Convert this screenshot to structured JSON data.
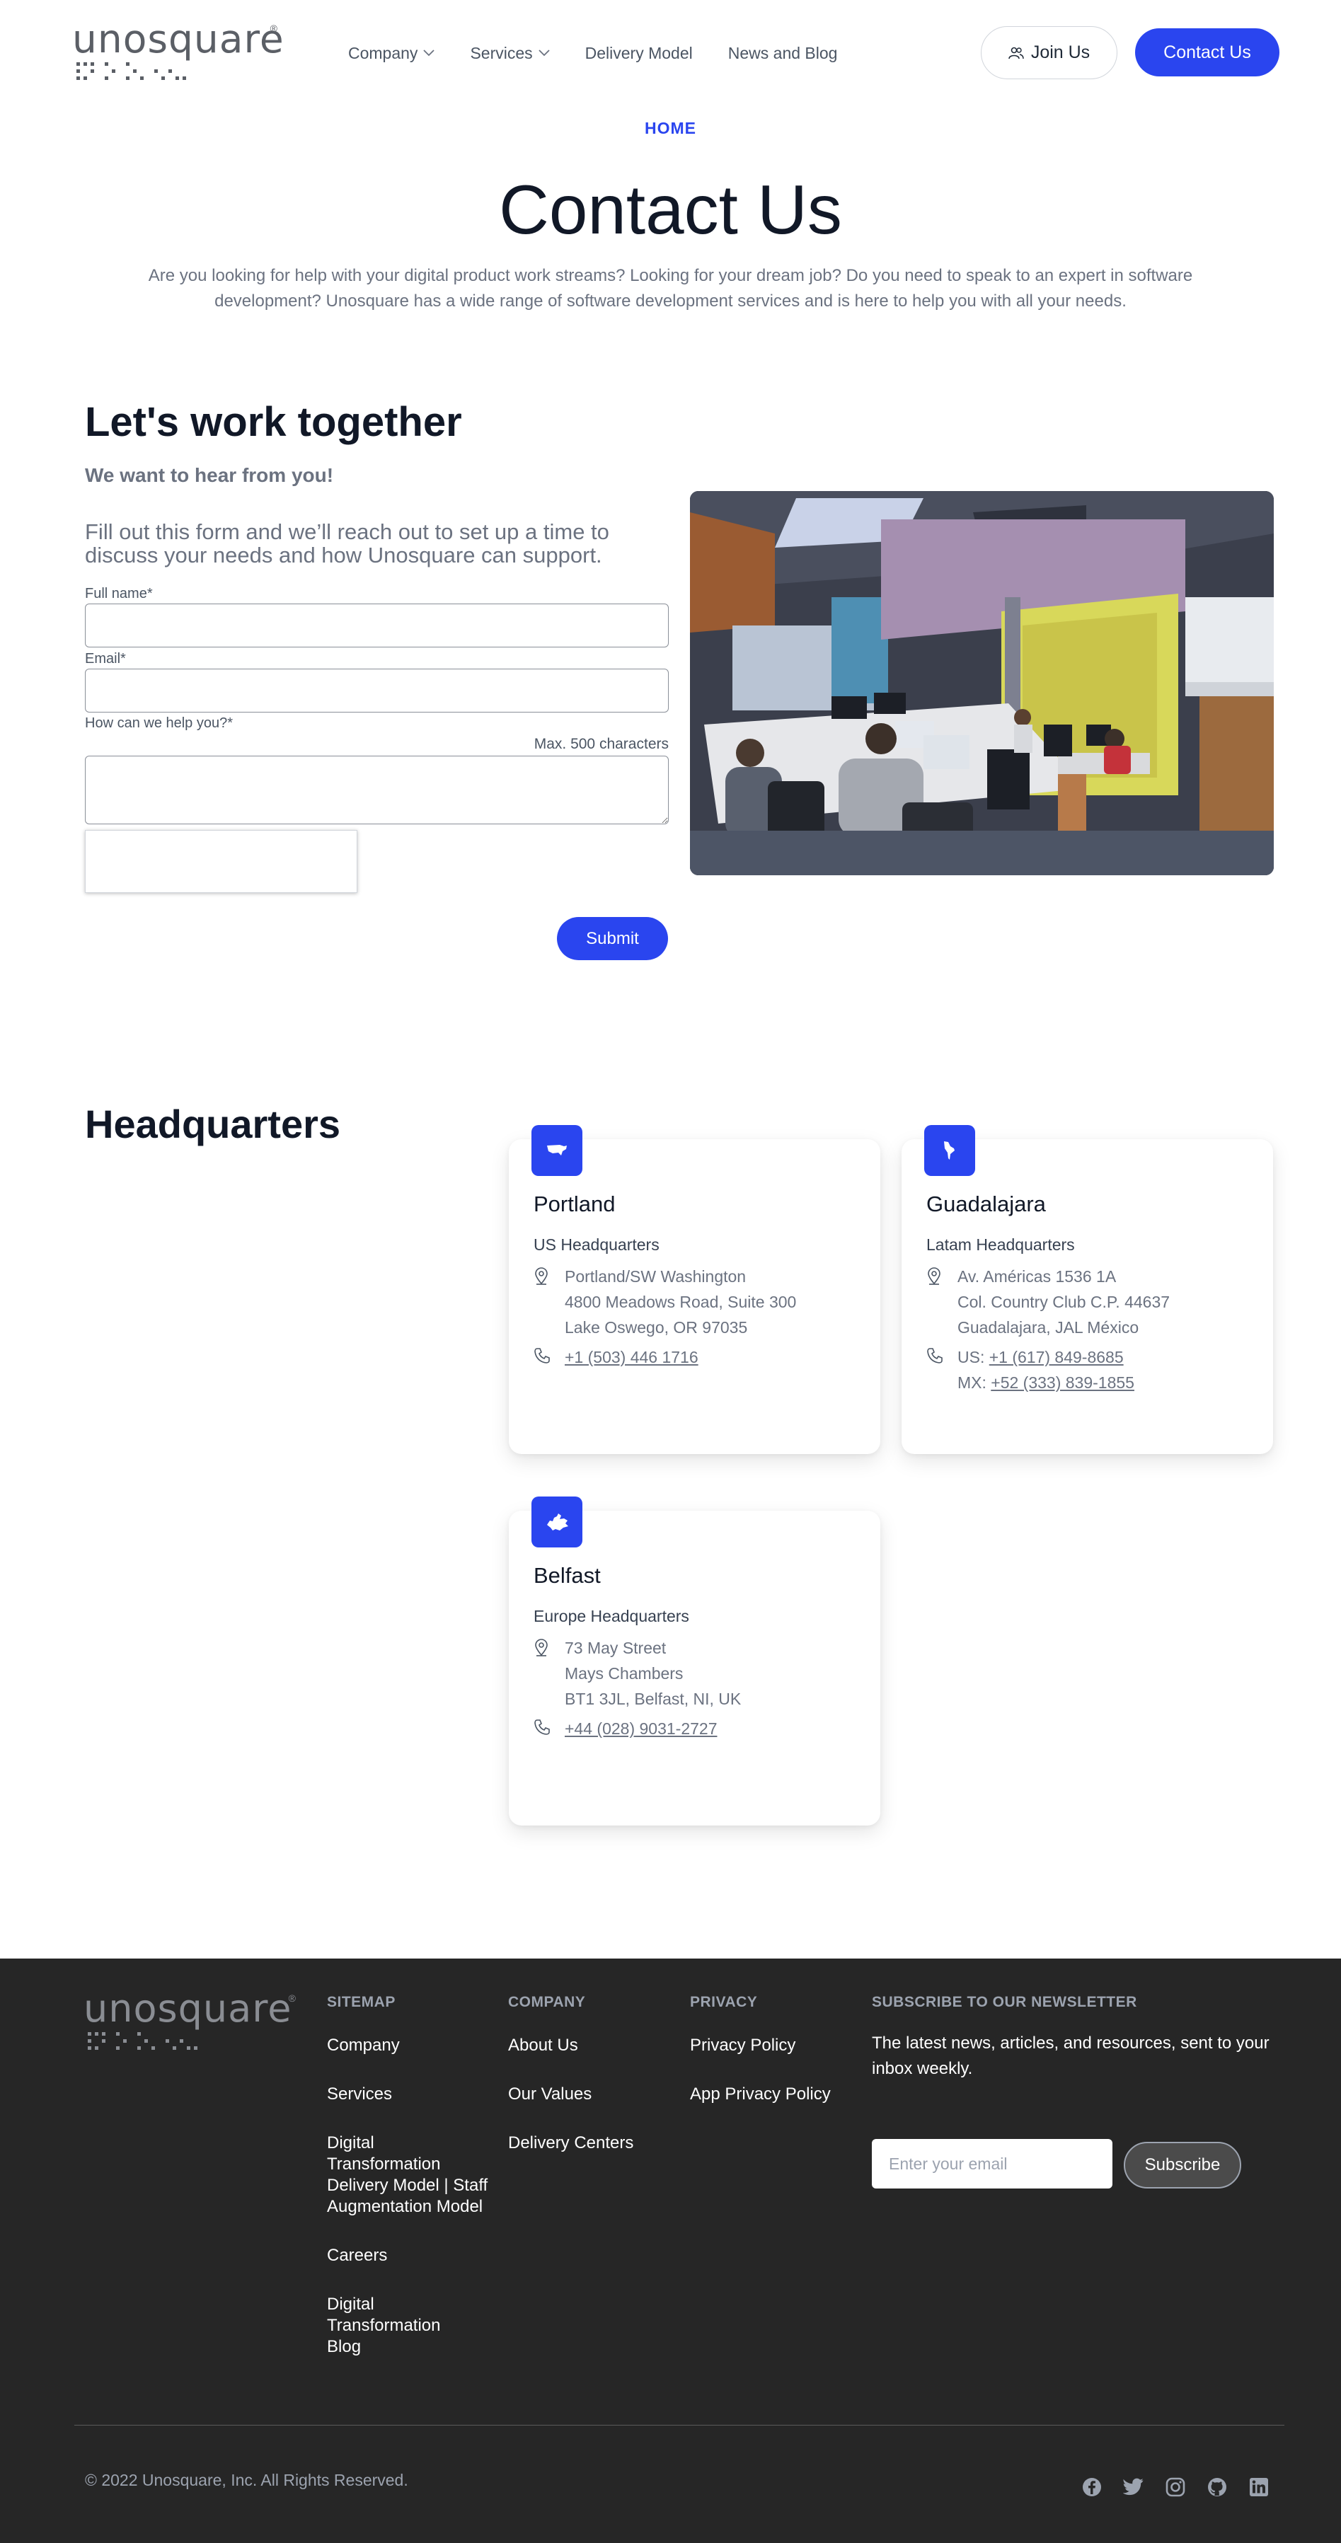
{
  "header": {
    "logo_text": "unosquare",
    "nav": [
      {
        "label": "Company",
        "dropdown": true
      },
      {
        "label": "Services",
        "dropdown": true
      },
      {
        "label": "Delivery Model",
        "dropdown": false
      },
      {
        "label": "News and Blog",
        "dropdown": false
      }
    ],
    "join_label": "Join Us",
    "contact_label": "Contact Us"
  },
  "hero": {
    "breadcrumb": "HOME",
    "title": "Contact Us",
    "description": "Are you looking for help with your digital product work streams? Looking for your dream job? Do you need to speak to an expert in software development? Unosquare has a wide range of software development services and is here to help you with all your needs."
  },
  "form": {
    "title": "Let's work together",
    "subtitle": "We want to hear from you!",
    "intro": "Fill out this form and we’ll reach out to set up a time to discuss your needs and how Unosquare can support.",
    "full_name_label": "Full name*",
    "full_name_value": "",
    "email_label": "Email*",
    "email_value": "",
    "help_label": "How can we help you?*",
    "help_max": "Max. 500 characters",
    "help_value": "",
    "submit_label": "Submit"
  },
  "headquarters": {
    "title": "Headquarters",
    "offices": [
      {
        "city": "Portland",
        "type": "US Headquarters",
        "icon": "usa-map-icon",
        "address": [
          "Portland/SW Washington",
          "4800 Meadows Road, Suite 300",
          "Lake Oswego, OR 97035"
        ],
        "phones": [
          {
            "prefix": "",
            "number": "+1 (503) 446 1716"
          }
        ]
      },
      {
        "city": "Guadalajara",
        "type": "Latam Headquarters",
        "icon": "latam-map-icon",
        "address": [
          "Av. Américas 1536 1A",
          "Col. Country Club C.P. 44637",
          "Guadalajara, JAL México"
        ],
        "phones": [
          {
            "prefix": "US: ",
            "number": "+1 (617) 849-8685"
          },
          {
            "prefix": "MX: ",
            "number": "+52 (333) 839-1855"
          }
        ]
      },
      {
        "city": "Belfast",
        "type": "Europe Headquarters",
        "icon": "europe-map-icon",
        "address": [
          "73 May Street",
          "Mays Chambers",
          "BT1 3JL, Belfast, NI, UK"
        ],
        "phones": [
          {
            "prefix": "",
            "number": "+44 (028) 9031-2727"
          }
        ]
      }
    ]
  },
  "footer": {
    "logo_text": "unosquare",
    "sitemap": {
      "heading": "SITEMAP",
      "links": [
        "Company",
        "Services",
        "Digital Transformation Delivery Model | Staff Augmentation Model",
        "Careers",
        "Digital Transformation Blog"
      ]
    },
    "company": {
      "heading": "COMPANY",
      "links": [
        "About Us",
        "Our Values",
        "Delivery Centers"
      ]
    },
    "privacy": {
      "heading": "PRIVACY",
      "links": [
        "Privacy Policy",
        "App Privacy Policy"
      ]
    },
    "newsletter": {
      "heading": "SUBSCRIBE TO OUR NEWSLETTER",
      "text": "The latest news, articles, and resources, sent to your inbox weekly.",
      "placeholder": "Enter your email",
      "button": "Subscribe"
    },
    "copyright": "© 2022 Unosquare, Inc. All Rights Reserved.",
    "socials": [
      "facebook-icon",
      "twitter-icon",
      "instagram-icon",
      "github-icon",
      "linkedin-icon"
    ]
  },
  "colors": {
    "accent": "#2a45ef",
    "footer_bg": "#262626",
    "text_muted": "#6b7280"
  }
}
